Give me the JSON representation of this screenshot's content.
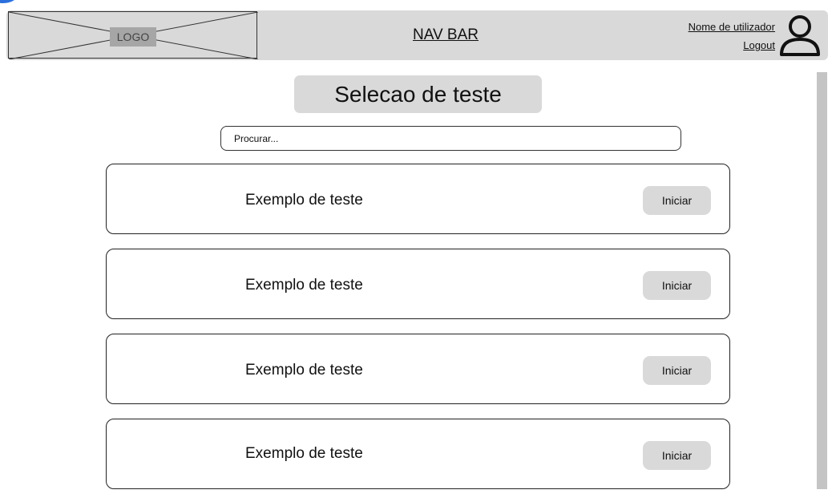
{
  "navbar": {
    "logo_label": "LOGO",
    "title": "NAV BAR",
    "user_name": "Nome de utilizador",
    "logout_label": "Logout",
    "user_icon": "user-icon"
  },
  "page": {
    "title": "Selecao de teste"
  },
  "search": {
    "placeholder": "Procurar..."
  },
  "tests": [
    {
      "label": "Exemplo de teste",
      "button_label": "Iniciar"
    },
    {
      "label": "Exemplo de teste",
      "button_label": "Iniciar"
    },
    {
      "label": "Exemplo de teste",
      "button_label": "Iniciar"
    },
    {
      "label": "Exemplo de teste",
      "button_label": "Iniciar"
    }
  ],
  "colors": {
    "navbar_bg": "#d9d9d9",
    "button_bg": "#d9d9d9",
    "scrollbar": "#c4c4c4",
    "corner_accent": "#2a6fdb"
  }
}
